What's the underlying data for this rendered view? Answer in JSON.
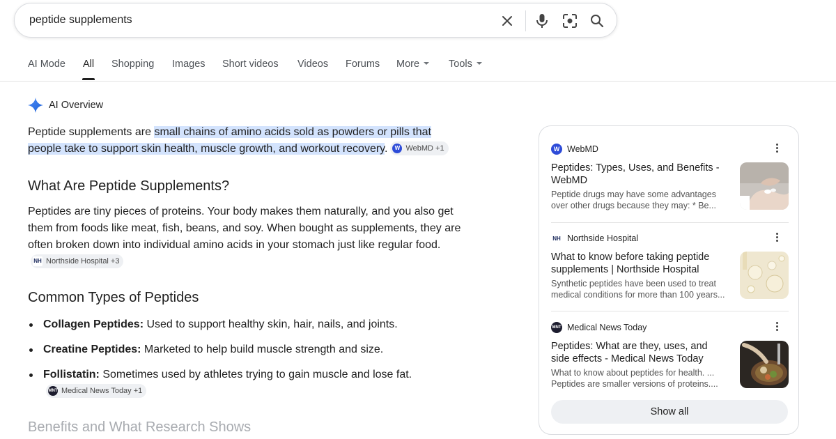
{
  "search": {
    "query": "peptide supplements",
    "icons": [
      "close-icon",
      "mic-icon",
      "lens-icon",
      "search-icon"
    ]
  },
  "tabs": [
    {
      "label": "AI Mode"
    },
    {
      "label": "All",
      "active": true
    },
    {
      "label": "Shopping"
    },
    {
      "label": "Images"
    },
    {
      "label": "Short videos"
    },
    {
      "label": "Videos"
    },
    {
      "label": "Forums"
    },
    {
      "label": "More"
    },
    {
      "label": "Tools"
    }
  ],
  "ai_overview": {
    "label": "AI Overview",
    "intro_plain": "Peptide supplements are ",
    "intro_highlight_1": "small chains of amino acids sold as powders or pills that",
    "intro_highlight_2": "people take to support skin health, muscle growth, and workout recovery",
    "intro_end": ".",
    "intro_chip": "WebMD +1",
    "h1": "What Are Peptide Supplements?",
    "p1": "Peptides are tiny pieces of proteins. Your body makes them naturally, and you also get them from foods like meat, fish, beans, and soy. When bought as supplements, they are often broken down into individual amino acids in your stomach just like regular food.",
    "p1_chip": "Northside Hospital +3",
    "h2": "Common Types of Peptides",
    "bullets": [
      {
        "term": "Collagen Peptides:",
        "text": " Used to support healthy skin, hair, nails, and joints."
      },
      {
        "term": "Creatine Peptides:",
        "text": " Marketed to help build muscle strength and size."
      },
      {
        "term": "Follistatin:",
        "text": " Sometimes used by athletes trying to gain muscle and lose fat.",
        "chip": "Medical News Today +1"
      }
    ],
    "h3": "Benefits and What Research Shows"
  },
  "sources": {
    "items": [
      {
        "site": "WebMD",
        "title": "Peptides: Types, Uses, and Benefits - WebMD",
        "snippet": "Peptide drugs may have some advantages over other drugs because they may: * Be..."
      },
      {
        "site": "Northside Hospital",
        "title": "What to know before taking peptide supplements | Northside Hospital",
        "snippet": "Synthetic peptides have been used to treat medical conditions for more than 100 years..."
      },
      {
        "site": "Medical News Today",
        "title": "Peptides: What are they, uses, and side effects - Medical News Today",
        "snippet": "What to know about peptides for health. ... Peptides are smaller versions of proteins...."
      }
    ],
    "show_all": "Show all"
  },
  "colors": {
    "highlight": "#d3e3fd",
    "chip_bg": "#eef0f3",
    "webmd_blue": "#2d4bd8",
    "faded_heading": "#a8abb0"
  }
}
